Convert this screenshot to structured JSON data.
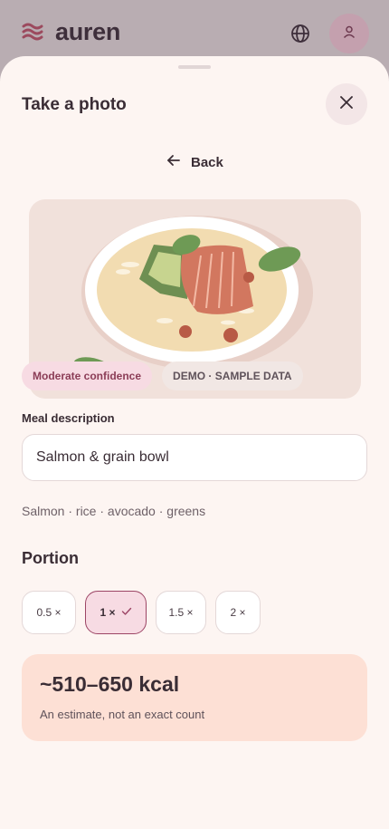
{
  "app": {
    "brand": "auren"
  },
  "sheet": {
    "title": "Take a photo",
    "back_label": "Back"
  },
  "badges": {
    "confidence": "Moderate confidence",
    "demo": "DEMO · SAMPLE DATA"
  },
  "meal": {
    "label": "Meal description",
    "value": "Salmon & grain bowl",
    "ingredients": "Salmon · rice · avocado · greens"
  },
  "portion": {
    "title": "Portion",
    "options": [
      "0.5 ×",
      "1 ×",
      "1.5 ×",
      "2 ×"
    ],
    "selected": "1 ×"
  },
  "estimate": {
    "value": "~510–650 kcal",
    "note": "An estimate, not an exact count"
  },
  "icons": {
    "logo": "waves-logo-icon",
    "globe": "globe-icon",
    "user": "user-icon",
    "close": "close-icon",
    "back": "arrow-left-icon",
    "check": "check-icon"
  },
  "colors": {
    "accent": "#9c4565",
    "sheet_bg": "#fdf5f2",
    "estimate_bg": "#fde0d5"
  }
}
